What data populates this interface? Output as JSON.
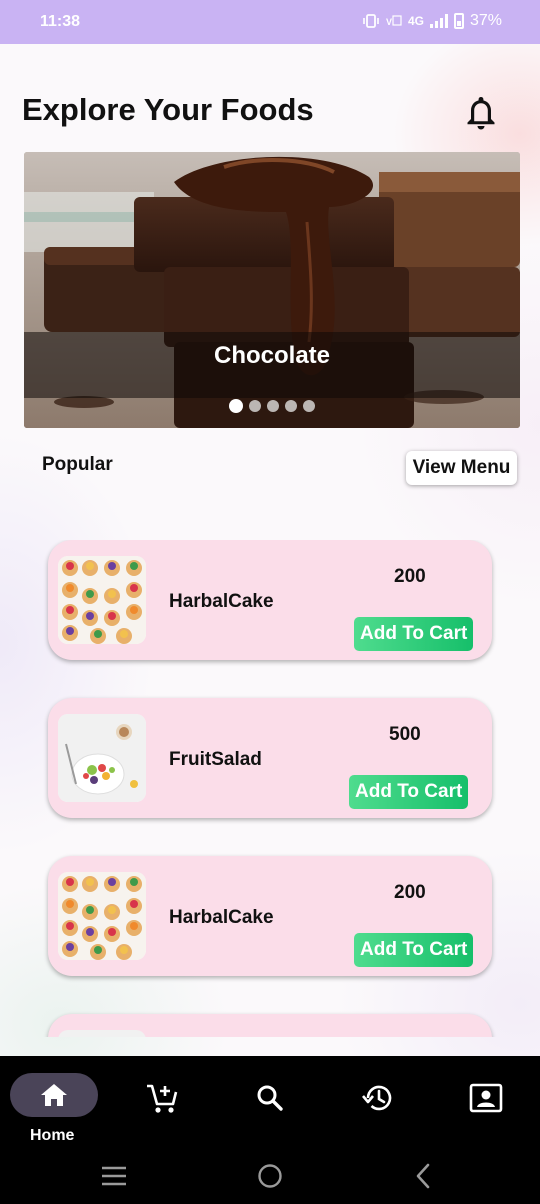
{
  "status_bar": {
    "time": "11:38",
    "network": "4G",
    "battery": "37%",
    "icons": [
      "vibrate-icon",
      "volte-icon",
      "signal-icon",
      "battery-icon"
    ]
  },
  "header": {
    "title": "Explore Your Foods",
    "bell_icon": "bell-icon"
  },
  "banner": {
    "caption": "Chocolate",
    "slide_count": 5,
    "active_slide": 1
  },
  "popular": {
    "label": "Popular",
    "view_menu_label": "View Menu"
  },
  "foods": [
    {
      "name": "HarbalCake",
      "price": "200",
      "button": "Add To Cart",
      "image": "cupcakes-image"
    },
    {
      "name": "FruitSalad",
      "price": "500",
      "button": "Add To Cart",
      "image": "fruit-salad-image"
    },
    {
      "name": "HarbalCake",
      "price": "200",
      "button": "Add To Cart",
      "image": "cupcakes-image"
    }
  ],
  "bottom_nav": {
    "items": [
      {
        "icon": "home-icon",
        "label": "Home",
        "active": true
      },
      {
        "icon": "cart-add-icon"
      },
      {
        "icon": "search-icon"
      },
      {
        "icon": "history-icon"
      },
      {
        "icon": "profile-icon"
      }
    ]
  },
  "colors": {
    "status_bar": "#c9b3f3",
    "card": "#fbdde9",
    "add_button": "#16bf6a",
    "nav_bg": "#000000",
    "nav_active_pill": "#4a4458"
  }
}
